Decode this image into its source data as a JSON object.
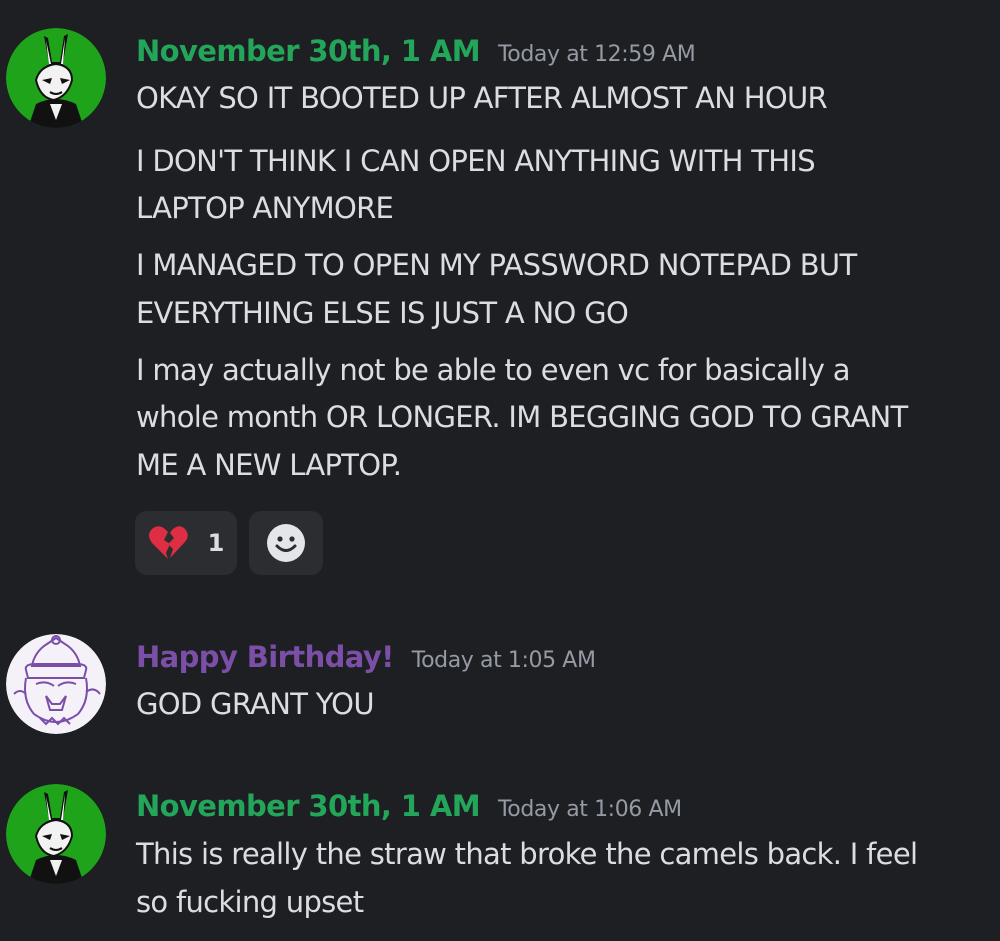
{
  "colors": {
    "background": "#1e1f22",
    "user1_name": "#23a55a",
    "user2_name": "#7b4fa8",
    "timestamp": "#949ba4",
    "text": "#dbdee1",
    "reaction_bg": "#2b2d31"
  },
  "messages": [
    {
      "username": "November 30th, 1 AM",
      "timestamp": "Today at 12:59 AM",
      "avatar_icon": "masked-rabbit-avatar",
      "lines": [
        "OKAY SO IT BOOTED UP AFTER ALMOST AN HOUR",
        "I DON'T THINK I CAN OPEN ANYTHING WITH THIS",
        "LAPTOP ANYMORE",
        "I MANAGED TO OPEN MY PASSWORD NOTEPAD BUT",
        "EVERYTHING ELSE IS JUST A NO GO",
        "I may actually not be able to even vc for basically a",
        "whole month OR LONGER. IM BEGGING GOD TO GRANT",
        "ME A NEW LAPTOP."
      ],
      "reactions": [
        {
          "emoji": "broken-heart-icon",
          "count": "1"
        },
        {
          "emoji": "add-reaction-icon"
        }
      ]
    },
    {
      "username": "Happy Birthday!",
      "timestamp": "Today at 1:05 AM",
      "avatar_icon": "party-hat-sketch-avatar",
      "lines": [
        "GOD GRANT YOU"
      ]
    },
    {
      "username": "November 30th, 1 AM",
      "timestamp": "Today at 1:06 AM",
      "avatar_icon": "masked-rabbit-avatar",
      "lines": [
        "This is really the straw that broke the camels back. I feel",
        "so fucking upset"
      ]
    }
  ]
}
